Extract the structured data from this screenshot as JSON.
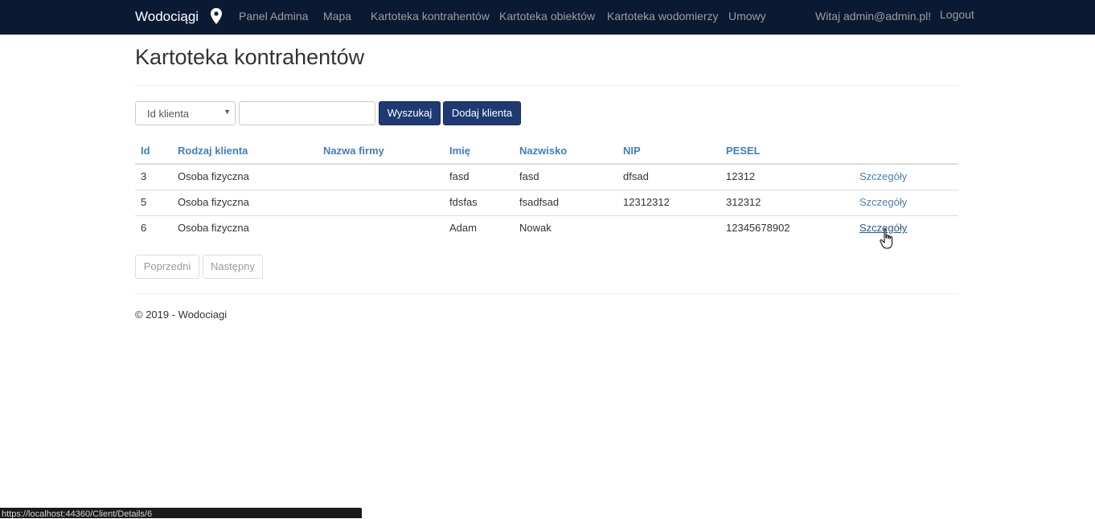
{
  "navbar": {
    "brand": "Wodociągi",
    "links": [
      "Panel Admina",
      "Mapa",
      "Kartoteka kontrahentów",
      "Kartoteka obiektów",
      "Kartoteka wodomierzy",
      "Umowy"
    ],
    "greeting": "Witaj admin@admin.pl!",
    "logout": "Logout"
  },
  "page": {
    "title": "Kartoteka kontrahentów"
  },
  "search": {
    "select_value": "Id klienta",
    "input_value": "",
    "search_button": "Wyszukaj",
    "add_button": "Dodaj klienta"
  },
  "table": {
    "headers": [
      "Id",
      "Rodzaj klienta",
      "Nazwa firmy",
      "Imię",
      "Nazwisko",
      "NIP",
      "PESEL"
    ],
    "rows": [
      [
        "3",
        "Osoba fizyczna",
        "",
        "fasd",
        "fasd",
        "dfsad",
        "12312",
        "Szczegóły"
      ],
      [
        "5",
        "Osoba fizyczna",
        "",
        "fdsfas",
        "fsadfsad",
        "12312312",
        "312312",
        "Szczegóły"
      ],
      [
        "6",
        "Osoba fizyczna",
        "",
        "Adam",
        "Nowak",
        "",
        "12345678902",
        "Szczegóły"
      ]
    ]
  },
  "pager": {
    "prev": "Poprzedni",
    "next": "Następny"
  },
  "footer": {
    "text": "© 2019 - Wodociagi"
  },
  "status_bar": {
    "url": "https://localhost:44360/Client/Details/6"
  },
  "colors": {
    "navbar_bg": "#0b1a33",
    "button_bg": "#1f3a73",
    "header_text": "#3f7fbf",
    "link": "#4a7fb5"
  }
}
